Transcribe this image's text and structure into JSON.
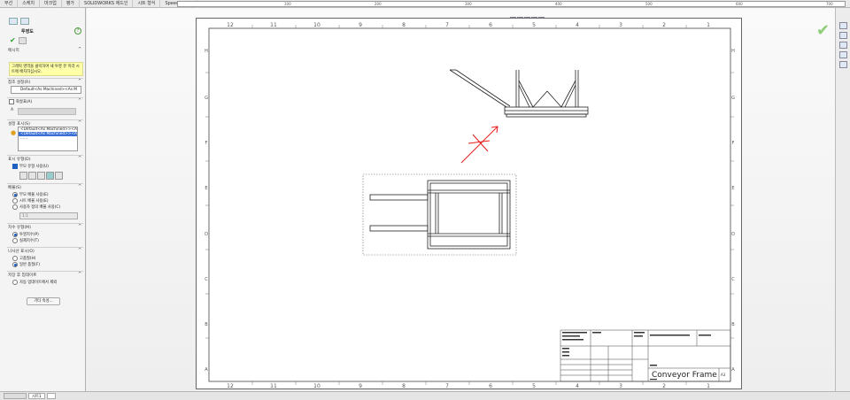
{
  "top_tabs": [
    "부선",
    "스케치",
    "마크업",
    "평가",
    "SOLIDWORKS 애드인",
    "시트 형식",
    "SpeedWorks"
  ],
  "ruler_labels": [
    "100",
    "200",
    "300",
    "400",
    "500",
    "600",
    "700"
  ],
  "panel": {
    "title": "투영도",
    "help": "?",
    "message_header": "메시지",
    "message_text": "그래픽 영역을 클릭하여 새 투영 뷰 미러 시트에 배치하십시오.",
    "reference_config_header": "참조 설정(R)",
    "reference_config_value": "Default<As Machined><As M",
    "arrow_header": "화살표(A)",
    "arrow_label": "A",
    "config_display_header": "설정 표시(S)",
    "config_list": [
      "<Default<As Machined>><As Ma",
      "<Default<As Machined>><As Ma",
      "......"
    ],
    "display_style_header": "표시 유형(D)",
    "use_parent_style": "부모 유형 사용(U)",
    "scale_header": "배율(S)",
    "scale_opt1": "부모 배율 사용(E)",
    "scale_opt2": "시트 배율 사용(E)",
    "scale_opt3": "사용자 정의 배율 사용(C)",
    "scale_value": "1:1",
    "dim_type_header": "치수 유형(M)",
    "dim_opt1": "투영치수(P)",
    "dim_opt2": "실제치수(T)",
    "thread_header": "나사산 표시(O)",
    "thread_opt1": "고품질(H)",
    "thread_opt2": "일반 품질(F)",
    "save_header": "저장 후 업데이트",
    "save_opt": "자동 업데이트에서 제외",
    "more_button": "기타 속성..."
  },
  "sheet": {
    "col_labels": [
      "12",
      "11",
      "10",
      "9",
      "8",
      "7",
      "6",
      "5",
      "4",
      "3",
      "2",
      "1"
    ],
    "row_labels": [
      "H",
      "G",
      "F",
      "E",
      "D",
      "C",
      "B",
      "A"
    ],
    "title": "Conveyor Frame",
    "size": "A3"
  },
  "statusbar": {
    "sheet_tab": "시트1"
  },
  "colors": {
    "accent": "#1f5fbf",
    "message_bg": "#ffffa8",
    "arrow_red": "#e81c1c",
    "ok_green": "#2aa02a"
  },
  "icons": [
    "confirm-check-icon",
    "cancel-icon",
    "help-icon",
    "arrow-icon",
    "radio-icon",
    "checkbox-icon"
  ]
}
